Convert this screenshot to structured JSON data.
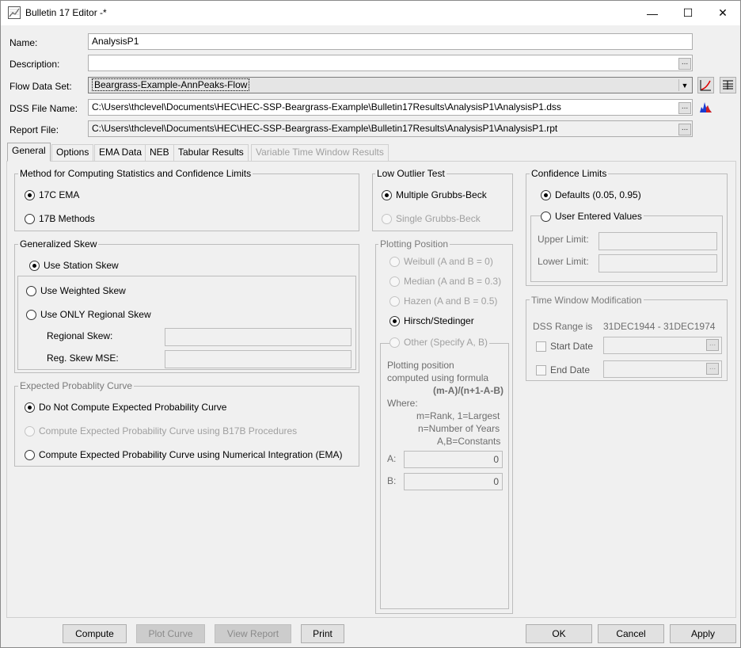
{
  "window": {
    "title": "Bulletin 17 Editor -*",
    "minimize": "—",
    "maximize": "☐",
    "close": "✕"
  },
  "form": {
    "name_label": "Name:",
    "name_value": "AnalysisP1",
    "description_label": "Description:",
    "description_value": "",
    "flow_label": "Flow Data Set:",
    "flow_value": "Beargrass-Example-AnnPeaks-Flow",
    "dss_label": "DSS File Name:",
    "dss_value": "C:\\Users\\thclevel\\Documents\\HEC\\HEC-SSP-Beargrass-Example\\Bulletin17Results\\AnalysisP1\\AnalysisP1.dss",
    "report_label": "Report File:",
    "report_value": "C:\\Users\\thclevel\\Documents\\HEC\\HEC-SSP-Beargrass-Example\\Bulletin17Results\\AnalysisP1\\AnalysisP1.rpt",
    "ellipsis": "..."
  },
  "tabs": [
    "General",
    "Options",
    "EMA Data",
    "NEB",
    "Tabular Results",
    "Variable Time Window Results"
  ],
  "method": {
    "title": "Method for Computing Statistics and Confidence Limits",
    "opt1": "17C EMA",
    "opt2": "17B Methods"
  },
  "skew": {
    "title": "Generalized Skew",
    "station": "Use Station Skew",
    "weighted": "Use Weighted Skew",
    "regional_only": "Use ONLY Regional Skew",
    "regional_skew_label": "Regional Skew:",
    "reg_mse_label": "Reg. Skew MSE:"
  },
  "expected": {
    "title": "Expected Probablity Curve",
    "opt1": "Do Not Compute Expected Probability Curve",
    "opt2": "Compute Expected Probability Curve using B17B Procedures",
    "opt3": "Compute Expected Probability Curve using Numerical Integration (EMA)"
  },
  "outlier": {
    "title": "Low Outlier Test",
    "opt1": "Multiple Grubbs-Beck",
    "opt2": "Single Grubbs-Beck"
  },
  "plotting": {
    "title": "Plotting Position",
    "weibull": "Weibull (A and B = 0)",
    "median": "Median (A and B = 0.3)",
    "hazen": "Hazen (A and B = 0.5)",
    "hirsch": "Hirsch/Stedinger",
    "other": "Other (Specify A, B)",
    "formula_line1": "Plotting position",
    "formula_line2": "computed using formula",
    "formula": "(m-A)/(n+1-A-B)",
    "where": "Where:",
    "where1": "m=Rank, 1=Largest",
    "where2": "n=Number of Years",
    "where3": "A,B=Constants",
    "a_label": "A:",
    "a_value": "0",
    "b_label": "B:",
    "b_value": "0"
  },
  "confidence": {
    "title": "Confidence Limits",
    "defaults": "Defaults (0.05, 0.95)",
    "user": "User Entered Values",
    "upper_label": "Upper Limit:",
    "lower_label": "Lower Limit:"
  },
  "timewindow": {
    "title": "Time Window Modification",
    "range_label": "DSS Range is",
    "range_value": "31DEC1944 - 31DEC1974",
    "start_label": "Start Date",
    "end_label": "End Date"
  },
  "buttons": {
    "compute": "Compute",
    "plot_curve": "Plot Curve",
    "view_report": "View Report",
    "print": "Print",
    "ok": "OK",
    "cancel": "Cancel",
    "apply": "Apply"
  }
}
